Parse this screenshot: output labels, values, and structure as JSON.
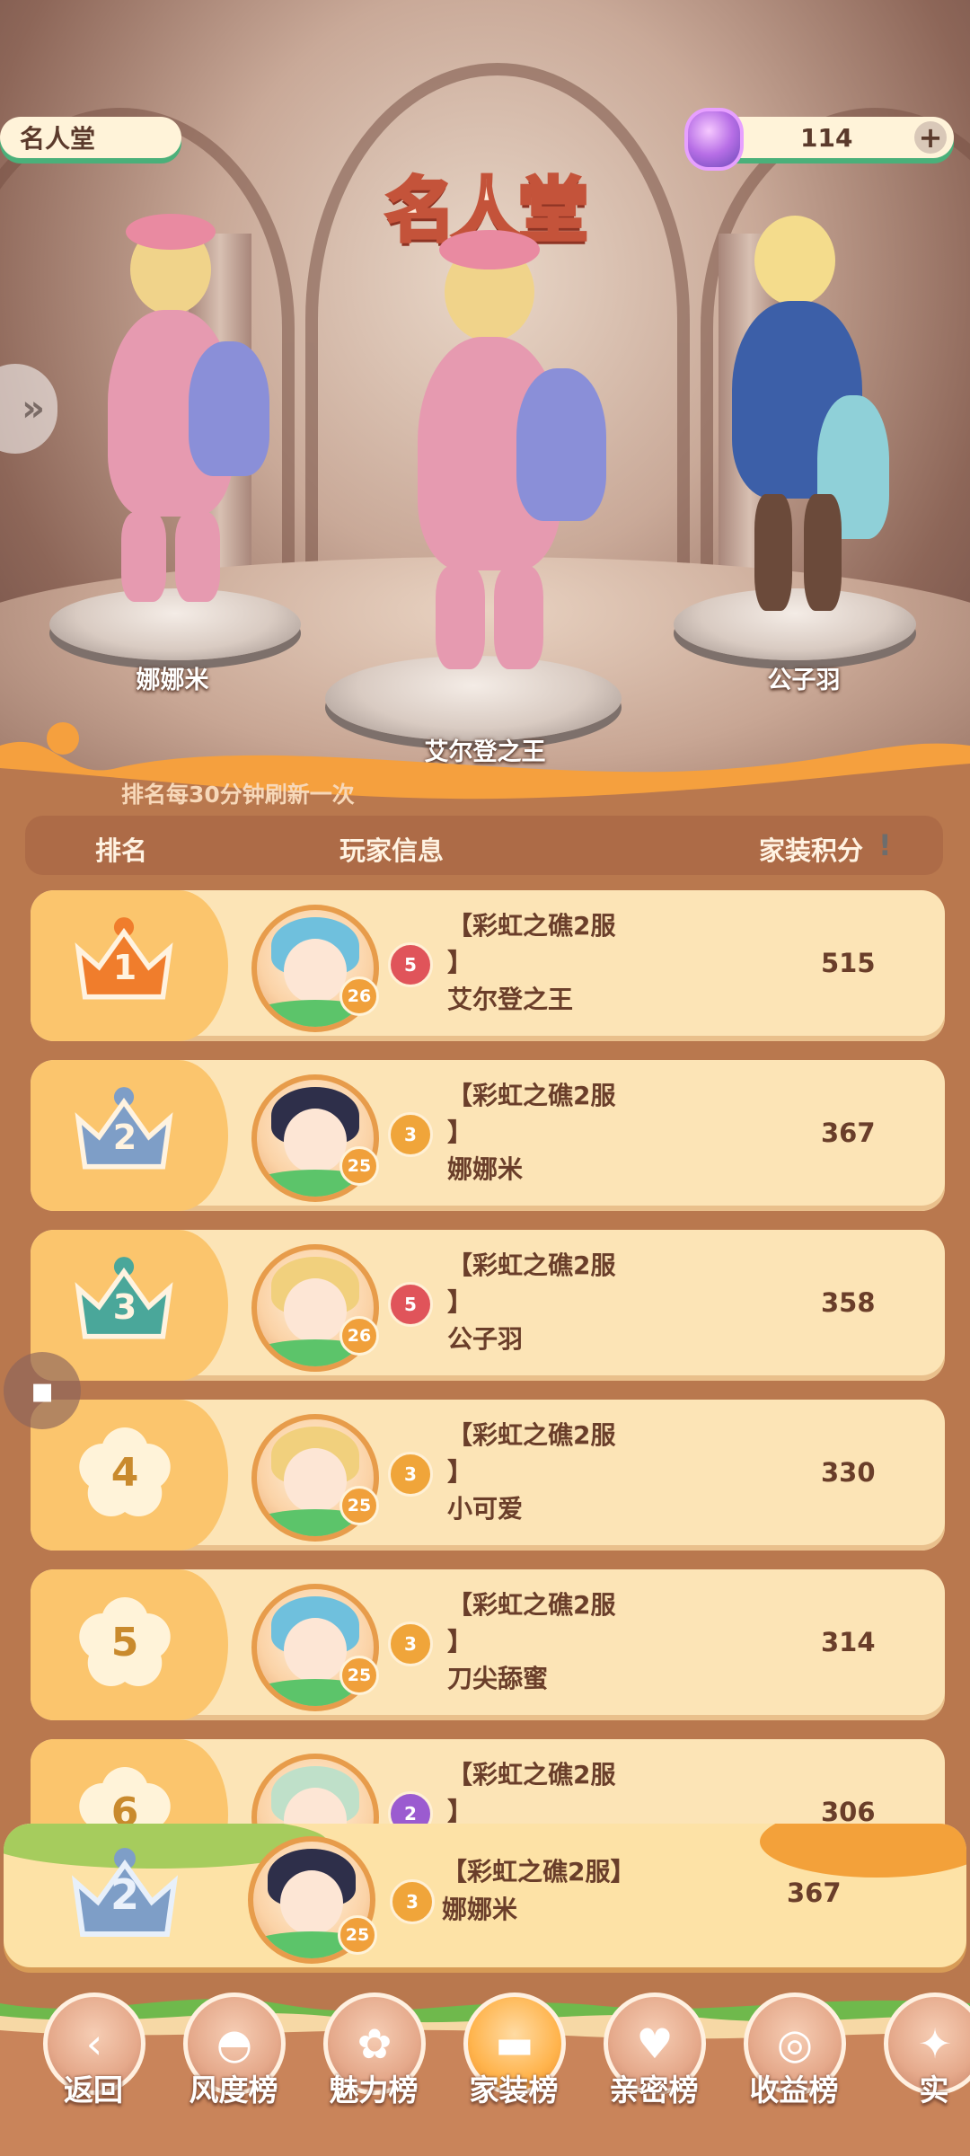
{
  "header": {
    "page_title": "名人堂",
    "hall_title": "名人堂",
    "currency_amount": "114",
    "add_symbol": "+"
  },
  "podium": [
    {
      "name": "娜娜米"
    },
    {
      "name": "艾尔登之王"
    },
    {
      "name": "公子羽"
    }
  ],
  "notice": "排名每30分钟刷新一次",
  "table_header": {
    "rank": "排名",
    "player": "玩家信息",
    "score": "家装积分"
  },
  "rows": [
    {
      "rank": "1",
      "level": "26",
      "tier": "5",
      "server": "【彩虹之礁2服",
      "bracket": "】",
      "name": "艾尔登之王",
      "score": "515"
    },
    {
      "rank": "2",
      "level": "25",
      "tier": "3",
      "server": "【彩虹之礁2服",
      "bracket": "】",
      "name": "娜娜米",
      "score": "367"
    },
    {
      "rank": "3",
      "level": "26",
      "tier": "5",
      "server": "【彩虹之礁2服",
      "bracket": "】",
      "name": "公子羽",
      "score": "358"
    },
    {
      "rank": "4",
      "level": "25",
      "tier": "3",
      "server": "【彩虹之礁2服",
      "bracket": "】",
      "name": "小可爱",
      "score": "330"
    },
    {
      "rank": "5",
      "level": "25",
      "tier": "3",
      "server": "【彩虹之礁2服",
      "bracket": "】",
      "name": "刀尖舔蜜",
      "score": "314"
    },
    {
      "rank": "6",
      "level": "",
      "tier": "2",
      "server": "【彩虹之礁2服",
      "bracket": "】",
      "name": "",
      "score": "306"
    }
  ],
  "my_rank": {
    "rank": "2",
    "level": "25",
    "tier": "3",
    "server": "【彩虹之礁2服】",
    "name": "娜娜米",
    "score": "367"
  },
  "tabs": [
    {
      "label": "返回",
      "icon": "back-arrow-icon"
    },
    {
      "label": "风度榜",
      "icon": "hat-icon"
    },
    {
      "label": "魅力榜",
      "icon": "rose-icon"
    },
    {
      "label": "家装榜",
      "icon": "sofa-icon"
    },
    {
      "label": "亲密榜",
      "icon": "heart-icon"
    },
    {
      "label": "收益榜",
      "icon": "coins-icon"
    },
    {
      "label": "实",
      "icon": "partial-tab-icon"
    }
  ],
  "colors": {
    "rank1": "#f07d2c",
    "rank2": "#7e9ec7",
    "rank3": "#4aa79a",
    "rank_other": "#c98a2d",
    "tier5": "#e0545a",
    "tier3": "#f0a53a",
    "tier2": "#9b5bd0"
  }
}
